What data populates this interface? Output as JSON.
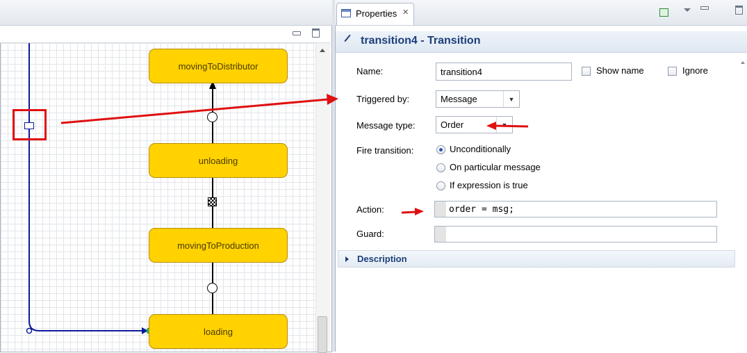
{
  "editor": {
    "states": [
      "movingToDistributor",
      "unloading",
      "movingToProduction",
      "loading"
    ]
  },
  "properties": {
    "tab_label": "Properties",
    "tab_close": "✕",
    "title": "transition4 - Transition",
    "name_label": "Name:",
    "name_value": "transition4",
    "show_name_label": "Show name",
    "ignore_label": "Ignore",
    "triggered_by_label": "Triggered by:",
    "triggered_by_value": "Message",
    "message_type_label": "Message type:",
    "message_type_value": "Order",
    "fire_transition_label": "Fire transition:",
    "fire_options": [
      "Unconditionally",
      "On particular message",
      "If expression is true"
    ],
    "fire_selected": "Unconditionally",
    "action_label": "Action:",
    "action_value": "order = msg;",
    "guard_label": "Guard:",
    "guard_value": "",
    "description_label": "Description"
  },
  "colors": {
    "state_fill": "#ffd200",
    "annotation_red": "#e01010",
    "transition_blue": "#0a1a9a",
    "title_blue": "#1b3f7a"
  }
}
